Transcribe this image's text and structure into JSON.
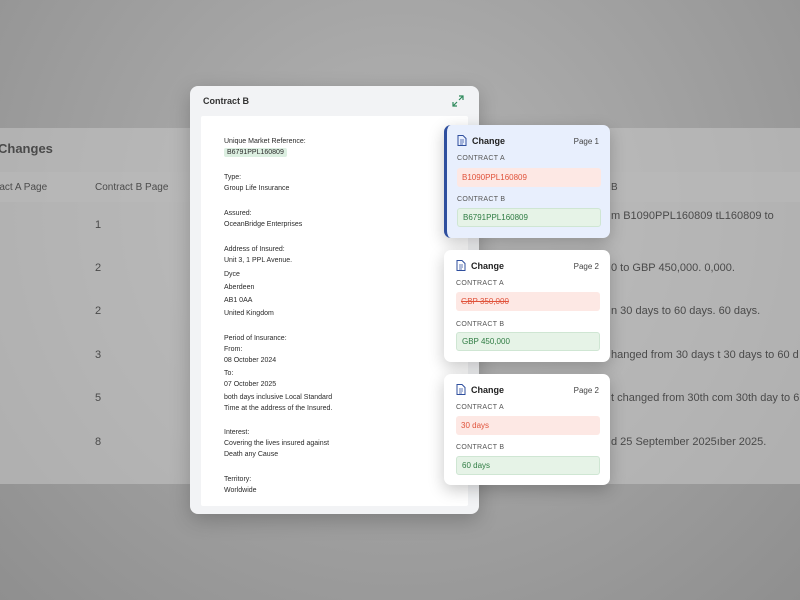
{
  "background_table": {
    "title": "Changes",
    "columns": [
      "ract A Page",
      "Contract B Page"
    ],
    "rows": [
      {
        "b_page": "1",
        "desc": "m B1090PPL160809 tL160809 to"
      },
      {
        "b_page": "2",
        "desc": "0 to GBP 450,000.     0,000."
      },
      {
        "b_page": "2",
        "desc": "n 30 days to 60 days.   60 days."
      },
      {
        "b_page": "3",
        "desc": "hanged from 30 days t 30 days to 60 d"
      },
      {
        "b_page": "5",
        "desc": "t changed from 30th com 30th day to 6"
      },
      {
        "b_page": "8",
        "desc": "d 25 September 2025ıber 2025."
      }
    ],
    "desc_header_fragment": "B"
  },
  "document": {
    "title": "Contract B",
    "lines": {
      "umr_label": "Unique Market Reference:",
      "umr_value": "B6791PPL160809",
      "type_label": "Type:",
      "type_value": "Group Life Insurance",
      "assured_label": "Assured:",
      "assured_value": "OceanBridge Enterprises",
      "address_label": "Address of Insured:",
      "address_1": "Unit 3, 1 PPL Avenue.",
      "address_2": "Dyce",
      "address_3": "Aberdeen",
      "address_4": "AB1 0AA",
      "address_5": "United Kingdom",
      "period_label": "Period of Insurance:",
      "from_label": "From:",
      "from_value": " 08 October 2024",
      "to_label": "To:",
      "to_value": " 07 October 2025",
      "period_note_1": "both days inclusive Local Standard",
      "period_note_2": "Time at the address of the Insured.",
      "interest_label": "Interest:",
      "interest_1": "Covering the lives insured against",
      "interest_2": "Death any Cause",
      "territory_label": "Territory:",
      "territory_value": "Worldwide"
    }
  },
  "changes": [
    {
      "label": "Change",
      "page": "Page 1",
      "contract_a_label": "CONTRACT A",
      "contract_a_value": "B1090PPL160809",
      "contract_b_label": "CONTRACT B",
      "contract_b_value": "B6791PPL160809"
    },
    {
      "label": "Change",
      "page": "Page 2",
      "contract_a_label": "CONTRACT A",
      "contract_a_value": "GBP 350,000",
      "contract_b_label": "CONTRACT B",
      "contract_b_value": "GBP 450,000"
    },
    {
      "label": "Change",
      "page": "Page 2",
      "contract_a_label": "CONTRACT A",
      "contract_a_value": "30 days",
      "contract_b_label": "CONTRACT B",
      "contract_b_value": "60 days"
    }
  ],
  "colors": {
    "old_value": "#e0533b",
    "new_value": "#2f7c43",
    "active_accent": "#2f4f9e"
  }
}
